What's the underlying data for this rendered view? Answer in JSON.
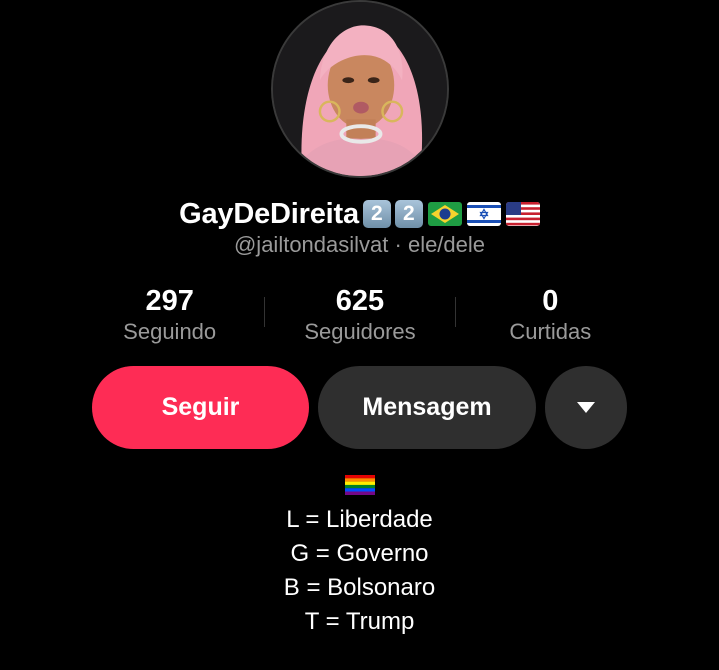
{
  "profile": {
    "display_name": "GayDeDireita",
    "name_emoji_1": "2",
    "name_emoji_2": "2",
    "name_flag_icons": [
      "brazil-flag-icon",
      "israel-flag-icon",
      "usa-flag-icon"
    ],
    "handle": "@jailtondasilvat",
    "separator": " · ",
    "pronouns": "ele/dele"
  },
  "stats": [
    {
      "value": "297",
      "label": "Seguindo"
    },
    {
      "value": "625",
      "label": "Seguidores"
    },
    {
      "value": "0",
      "label": "Curtidas"
    }
  ],
  "actions": {
    "follow_label": "Seguir",
    "message_label": "Mensagem",
    "more_icon": "triangle-down-icon"
  },
  "bio": {
    "flag_icon": "rainbow-flag-icon",
    "lines": [
      "L = Liberdade",
      "G = Governo",
      "B = Bolsonaro",
      "T = Trump"
    ]
  },
  "colors": {
    "background": "#000000",
    "follow_button": "#fe2c55",
    "secondary_button": "#2f2f2f",
    "muted_text": "#9a9a9a"
  }
}
